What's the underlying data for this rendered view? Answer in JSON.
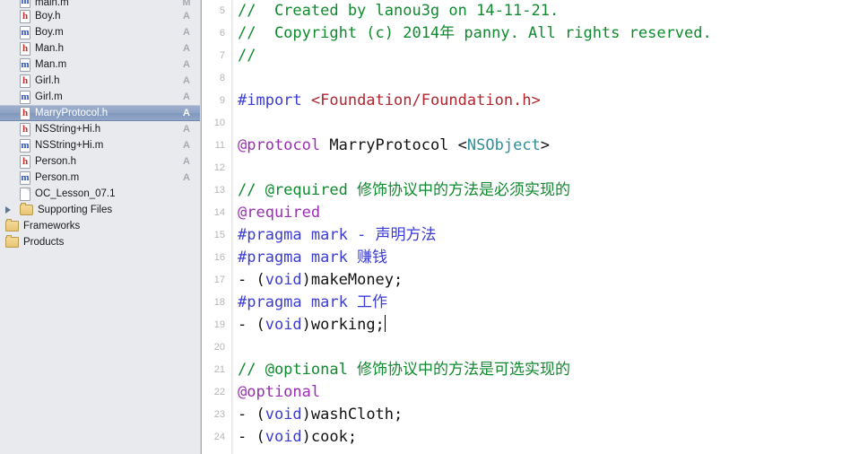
{
  "window": {
    "app": "Xcode",
    "accent_selection": "#8ea2c4",
    "comment_color": "#0f8a2e",
    "preprocessor_color": "#3b3bd6",
    "keyword_color": "#9a2fb3",
    "string_color": "#b0262f",
    "type_color": "#2f8f99"
  },
  "sidebar": {
    "name": "project-navigator",
    "items": [
      {
        "label": "main.m",
        "icon": "m-file-icon",
        "status": "M",
        "indent": 1,
        "selected": false,
        "clipped_top": true
      },
      {
        "label": "Boy.h",
        "icon": "h-file-icon",
        "status": "A",
        "indent": 1,
        "selected": false
      },
      {
        "label": "Boy.m",
        "icon": "m-file-icon",
        "status": "A",
        "indent": 1,
        "selected": false
      },
      {
        "label": "Man.h",
        "icon": "h-file-icon",
        "status": "A",
        "indent": 1,
        "selected": false
      },
      {
        "label": "Man.m",
        "icon": "m-file-icon",
        "status": "A",
        "indent": 1,
        "selected": false
      },
      {
        "label": "Girl.h",
        "icon": "h-file-icon",
        "status": "A",
        "indent": 1,
        "selected": false
      },
      {
        "label": "Girl.m",
        "icon": "m-file-icon",
        "status": "A",
        "indent": 1,
        "selected": false
      },
      {
        "label": "MarryProtocol.h",
        "icon": "h-file-icon",
        "status": "A",
        "indent": 1,
        "selected": true
      },
      {
        "label": "NSString+Hi.h",
        "icon": "h-file-icon",
        "status": "A",
        "indent": 1,
        "selected": false
      },
      {
        "label": "NSString+Hi.m",
        "icon": "m-file-icon",
        "status": "A",
        "indent": 1,
        "selected": false
      },
      {
        "label": "Person.h",
        "icon": "h-file-icon",
        "status": "A",
        "indent": 1,
        "selected": false
      },
      {
        "label": "Person.m",
        "icon": "m-file-icon",
        "status": "A",
        "indent": 1,
        "selected": false
      },
      {
        "label": "OC_Lesson_07.1",
        "icon": "plain-file-icon",
        "status": "",
        "indent": 1,
        "selected": false
      },
      {
        "label": "Supporting Files",
        "icon": "folder-icon",
        "status": "",
        "indent": 1,
        "selected": false,
        "disclosure": true
      },
      {
        "label": "Frameworks",
        "icon": "folder-icon",
        "status": "",
        "indent": 0,
        "selected": false
      },
      {
        "label": "Products",
        "icon": "folder-icon",
        "status": "",
        "indent": 0,
        "selected": false
      }
    ]
  },
  "editor": {
    "name": "source-editor",
    "file": "MarryProtocol.h",
    "first_visible_line": 5,
    "lines": [
      {
        "n": "5",
        "tokens": [
          {
            "t": "//  Created by lanou3g on 14-11-21.",
            "c": "cmt"
          }
        ]
      },
      {
        "n": "6",
        "tokens": [
          {
            "t": "//  Copyright (c) 2014年 panny. All rights reserved.",
            "c": "cmt"
          }
        ]
      },
      {
        "n": "7",
        "tokens": [
          {
            "t": "//",
            "c": "cmt"
          }
        ]
      },
      {
        "n": "8",
        "tokens": []
      },
      {
        "n": "9",
        "tokens": [
          {
            "t": "#import ",
            "c": "pre"
          },
          {
            "t": "<Foundation/Foundation.h>",
            "c": "str"
          }
        ]
      },
      {
        "n": "10",
        "tokens": []
      },
      {
        "n": "11",
        "tokens": [
          {
            "t": "@protocol",
            "c": "kw"
          },
          {
            "t": " MarryProtocol <",
            "c": "plain"
          },
          {
            "t": "NSObject",
            "c": "typ"
          },
          {
            "t": ">",
            "c": "plain"
          }
        ]
      },
      {
        "n": "12",
        "tokens": []
      },
      {
        "n": "13",
        "tokens": [
          {
            "t": "// @required 修饰协议中的方法是必须实现的",
            "c": "cmt"
          }
        ]
      },
      {
        "n": "14",
        "tokens": [
          {
            "t": "@required",
            "c": "kw"
          }
        ]
      },
      {
        "n": "15",
        "tokens": [
          {
            "t": "#pragma mark - 声明方法",
            "c": "pre"
          }
        ]
      },
      {
        "n": "16",
        "tokens": [
          {
            "t": "#pragma mark 赚钱",
            "c": "pre"
          }
        ]
      },
      {
        "n": "17",
        "tokens": [
          {
            "t": "- (",
            "c": "plain"
          },
          {
            "t": "void",
            "c": "pre"
          },
          {
            "t": ")makeMoney;",
            "c": "plain"
          }
        ]
      },
      {
        "n": "18",
        "tokens": [
          {
            "t": "#pragma mark 工作",
            "c": "pre"
          }
        ]
      },
      {
        "n": "19",
        "tokens": [
          {
            "t": "- (",
            "c": "plain"
          },
          {
            "t": "void",
            "c": "pre"
          },
          {
            "t": ")working;",
            "c": "plain"
          }
        ],
        "caret": true
      },
      {
        "n": "20",
        "tokens": []
      },
      {
        "n": "21",
        "tokens": [
          {
            "t": "// @optional 修饰协议中的方法是可选实现的",
            "c": "cmt"
          }
        ]
      },
      {
        "n": "22",
        "tokens": [
          {
            "t": "@optional",
            "c": "kw"
          }
        ]
      },
      {
        "n": "23",
        "tokens": [
          {
            "t": "- (",
            "c": "plain"
          },
          {
            "t": "void",
            "c": "pre"
          },
          {
            "t": ")washCloth;",
            "c": "plain"
          }
        ]
      },
      {
        "n": "24",
        "tokens": [
          {
            "t": "- (",
            "c": "plain"
          },
          {
            "t": "void",
            "c": "pre"
          },
          {
            "t": ")cook;",
            "c": "plain"
          }
        ]
      }
    ]
  }
}
